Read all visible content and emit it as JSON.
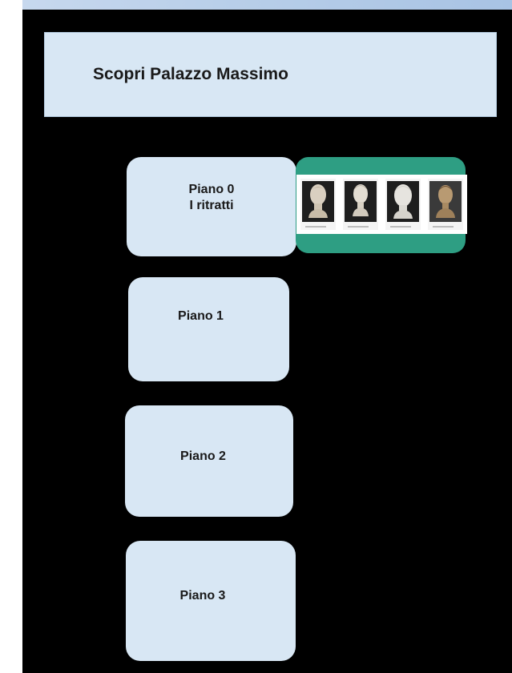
{
  "header": {
    "title": "Scopri Palazzo Massimo"
  },
  "floors": [
    {
      "label": "Piano 0",
      "sublabel": "I ritratti"
    },
    {
      "label": "Piano 1"
    },
    {
      "label": "Piano 2"
    },
    {
      "label": "Piano 3"
    }
  ],
  "gallery": {
    "items": [
      {
        "icon": "marble-portrait-bust-icon"
      },
      {
        "icon": "marble-portrait-bust-icon"
      },
      {
        "icon": "marble-portrait-bust-icon"
      },
      {
        "icon": "bronze-portrait-bust-icon"
      }
    ],
    "frame_color": "#2e9e83"
  },
  "colors": {
    "background": "#000000",
    "panel": "#d8e7f4",
    "accent": "#2e9e83"
  }
}
